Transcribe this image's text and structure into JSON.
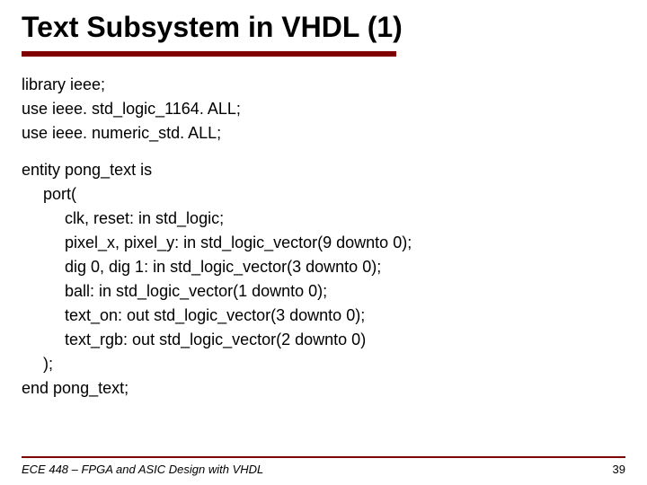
{
  "title": "Text Subsystem in VHDL (1)",
  "code": {
    "block1": {
      "l1": "library ieee;",
      "l2": "use ieee. std_logic_1164. ALL;",
      "l3": "use ieee. numeric_std. ALL;"
    },
    "block2": {
      "l1": "entity pong_text is",
      "l2": "port(",
      "l3": "clk, reset: in std_logic;",
      "l4": "pixel_x, pixel_y: in std_logic_vector(9 downto 0);",
      "l5": "dig 0, dig 1: in std_logic_vector(3 downto 0);",
      "l6": "ball: in std_logic_vector(1 downto 0);",
      "l7": "text_on: out std_logic_vector(3 downto 0);",
      "l8": "text_rgb: out std_logic_vector(2 downto 0)",
      "l9": ");",
      "l10": "end pong_text;"
    }
  },
  "footer": {
    "course": "ECE 448 – FPGA and ASIC Design with VHDL",
    "page": "39"
  }
}
